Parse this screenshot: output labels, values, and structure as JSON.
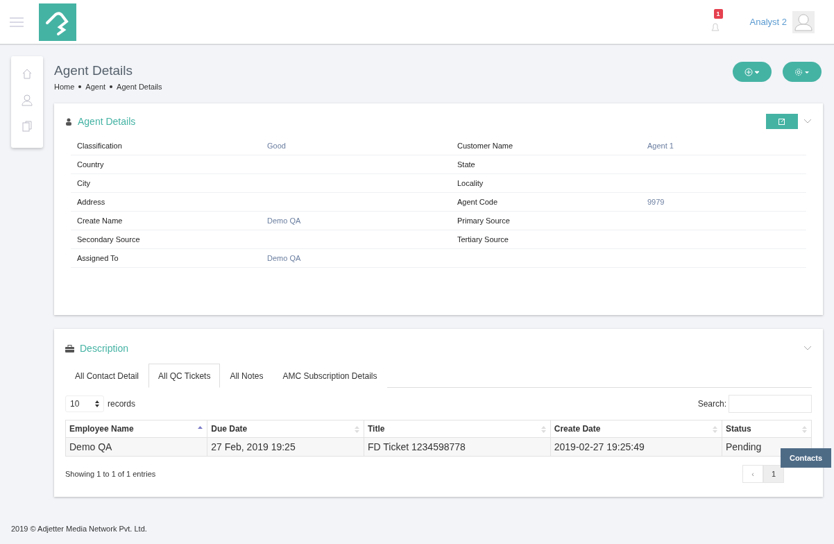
{
  "header": {
    "notification_count": "1",
    "user_name": "Analyst 2"
  },
  "sidebar": {
    "items": [
      {
        "kind": "home",
        "selected": false
      },
      {
        "kind": "user",
        "selected": false
      },
      {
        "kind": "docs",
        "selected": false
      }
    ]
  },
  "page": {
    "title": "Agent Details",
    "breadcrumb": [
      "Home",
      "Agent",
      "Agent Details"
    ]
  },
  "details": {
    "title": "Agent Details",
    "rows": [
      {
        "left": {
          "label": "Classification",
          "value": "Good"
        },
        "right": {
          "label": "Customer Name",
          "value": "Agent 1"
        }
      },
      {
        "left": {
          "label": "Country"
        },
        "right": {
          "label": "State"
        }
      },
      {
        "left": {
          "label": "City"
        },
        "right": {
          "label": "Locality"
        }
      },
      {
        "left": {
          "label": "Address"
        },
        "right": {
          "label": "Agent Code",
          "value": "9979"
        }
      },
      {
        "left": {
          "label": "Create Name",
          "value": "Demo QA"
        },
        "right": {
          "label": "Primary Source"
        }
      },
      {
        "left": {
          "label": "Secondary Source"
        },
        "right": {
          "label": "Tertiary Source"
        }
      },
      {
        "left": {
          "label": "Assigned To",
          "value": "Demo QA"
        }
      }
    ]
  },
  "description": {
    "title": "Description",
    "tabs": [
      {
        "label": "All Contact Detail",
        "selected": false
      },
      {
        "label": "All QC Tickets",
        "selected": true
      },
      {
        "label": "All Notes",
        "selected": false
      },
      {
        "label": "AMC Subscription Details",
        "selected": false
      }
    ],
    "page_size": "10",
    "records_label": "records",
    "search_label": "Search:",
    "columns": [
      {
        "label": "Employee Name",
        "sorted": true
      },
      {
        "label": "Due Date",
        "sorted": false
      },
      {
        "label": "Title",
        "sorted": false
      },
      {
        "label": "Create Date",
        "sorted": false
      },
      {
        "label": "Status",
        "sorted": false
      }
    ],
    "rows": [
      [
        "Demo QA",
        "27 Feb, 2019 19:25",
        "FD Ticket 1234598778",
        "2019-02-27 19:25:49",
        "Pending"
      ]
    ],
    "info": "Showing 1 to 1 of 1 entries",
    "pages": [
      {
        "label": "‹",
        "kind": "prev",
        "selected": false
      },
      {
        "label": "1",
        "kind": "page",
        "selected": true
      }
    ]
  },
  "contacts_tab": "Contacts",
  "footer": "2019 © Adjetter Media Network Pvt. Ltd."
}
